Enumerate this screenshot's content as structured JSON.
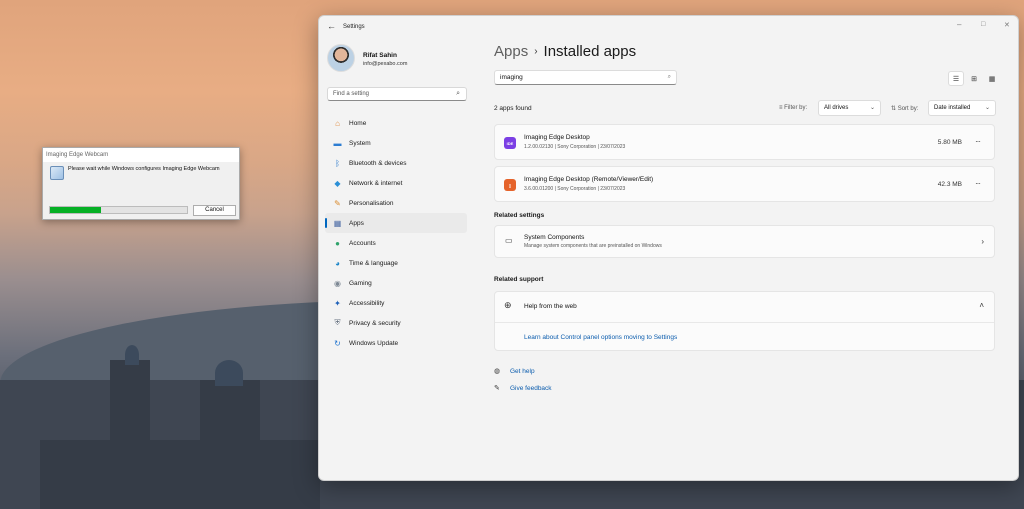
{
  "progress_dialog": {
    "title": "Imaging Edge Webcam",
    "message": "Please wait while Windows configures Imaging Edge Webcam",
    "progress": 0.37,
    "cancel_label": "Cancel"
  },
  "window": {
    "title": "Settings",
    "back_icon": "←",
    "min_icon": "–",
    "max_icon": "□",
    "close_icon": "✕"
  },
  "profile": {
    "name": "Rifat Sahin",
    "email": "info@pexabo.com"
  },
  "sidebar": {
    "search_placeholder": "Find a setting",
    "items": [
      {
        "label": "Home",
        "icon": "⌂",
        "color": "#e08a3c"
      },
      {
        "label": "System",
        "icon": "▬",
        "color": "#2d7dd2"
      },
      {
        "label": "Bluetooth & devices",
        "icon": "ᛒ",
        "color": "#1f72c9"
      },
      {
        "label": "Network & internet",
        "icon": "◆",
        "color": "#2a8fd6"
      },
      {
        "label": "Personalisation",
        "icon": "✎",
        "color": "#d98a2b"
      },
      {
        "label": "Apps",
        "icon": "▦",
        "color": "#4a6aa5"
      },
      {
        "label": "Accounts",
        "icon": "●",
        "color": "#2fa36b"
      },
      {
        "label": "Time & language",
        "icon": "◕",
        "color": "#1e86c8"
      },
      {
        "label": "Gaming",
        "icon": "◉",
        "color": "#7d8894"
      },
      {
        "label": "Accessibility",
        "icon": "✦",
        "color": "#1c5fb8"
      },
      {
        "label": "Privacy & security",
        "icon": "⛨",
        "color": "#6b7684"
      },
      {
        "label": "Windows Update",
        "icon": "↻",
        "color": "#1e73cf"
      }
    ],
    "active_index": 5
  },
  "main": {
    "breadcrumb_parent": "Apps",
    "breadcrumb_sep": "›",
    "breadcrumb_current": "Installed apps",
    "search_value": "imaging",
    "found_text": "2 apps found",
    "filter_label": "Filter by:",
    "filter_value": "All drives",
    "sort_label": "Sort by:",
    "sort_value": "Date installed",
    "apps": [
      {
        "name": "Imaging Edge Desktop",
        "meta": "1.2.00.02130 | Sony Corporation | 23/07/2023",
        "size": "5.80 MB",
        "icon_color": "#7b3fe4",
        "icon_text": "IDE"
      },
      {
        "name": "Imaging Edge Desktop (Remote/Viewer/Edit)",
        "meta": "3.6.00.01200 | Sony Corporation | 23/07/2023",
        "size": "42.3 MB",
        "icon_color": "#e5632b",
        "icon_text": "▯"
      }
    ],
    "more_icon": "···",
    "related_settings_title": "Related settings",
    "system_components_title": "System Components",
    "system_components_sub": "Manage system components that are preinstalled on Windows",
    "related_support_title": "Related support",
    "help_web": "Help from the web",
    "help_link": "Learn about Control panel options moving to Settings",
    "get_help": "Get help",
    "give_feedback": "Give feedback"
  }
}
